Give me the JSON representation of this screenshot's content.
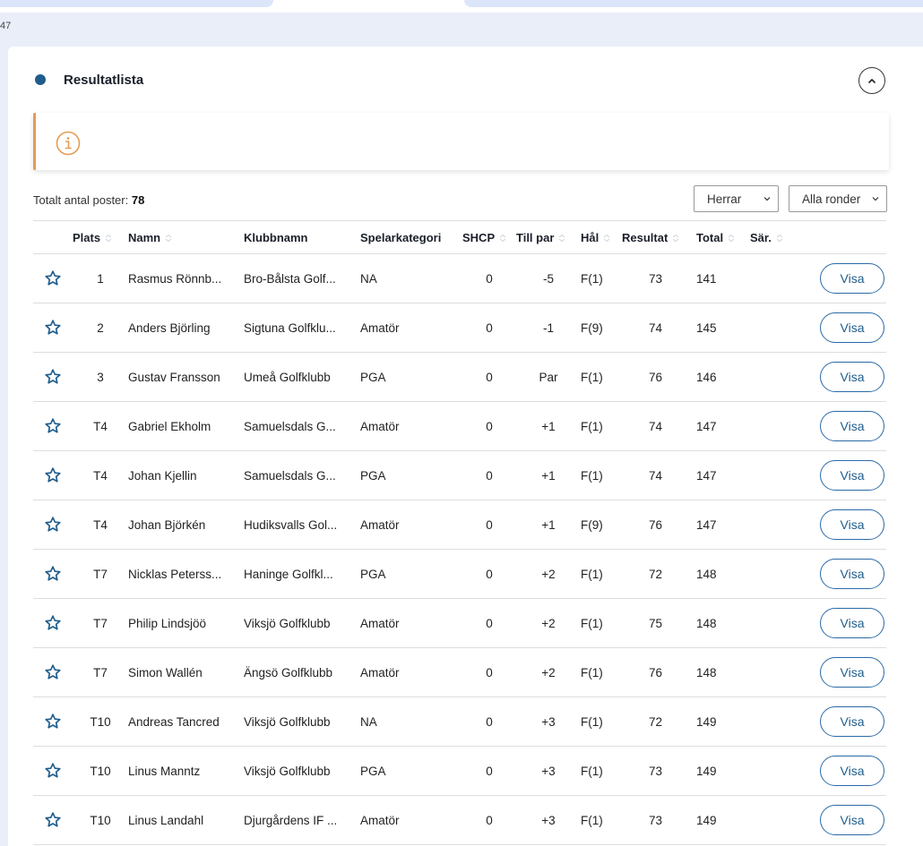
{
  "crumb": "47",
  "section": {
    "title": "Resultatlista"
  },
  "info": {
    "text": ""
  },
  "total": {
    "label": "Totalt antal poster: ",
    "count": "78"
  },
  "filters": {
    "gender": "Herrar",
    "rounds": "Alla ronder"
  },
  "columns": {
    "plats": "Plats",
    "namn": "Namn",
    "klubb": "Klubbnamn",
    "kategori": "Spelarkategori",
    "shcp": "SHCP",
    "tillpar": "Till par",
    "hal": "Hål",
    "resultat": "Resultat",
    "total": "Total",
    "sar": "Sär."
  },
  "visa_label": "Visa",
  "colors": {
    "accent": "#1f5d8c",
    "info": "#e59b56",
    "star": "#1f5d8c"
  },
  "rows": [
    {
      "plats": "1",
      "namn": "Rasmus Rönnb...",
      "klubb": "Bro-Bålsta Golf...",
      "kategori": "NA",
      "shcp": "0",
      "tillpar": "-5",
      "hal": "F(1)",
      "resultat": "73",
      "total": "141",
      "sar": ""
    },
    {
      "plats": "2",
      "namn": "Anders Björling",
      "klubb": "Sigtuna Golfklu...",
      "kategori": "Amatör",
      "shcp": "0",
      "tillpar": "-1",
      "hal": "F(9)",
      "resultat": "74",
      "total": "145",
      "sar": ""
    },
    {
      "plats": "3",
      "namn": "Gustav Fransson",
      "klubb": "Umeå Golfklubb",
      "kategori": "PGA",
      "shcp": "0",
      "tillpar": "Par",
      "hal": "F(1)",
      "resultat": "76",
      "total": "146",
      "sar": ""
    },
    {
      "plats": "T4",
      "namn": "Gabriel Ekholm",
      "klubb": "Samuelsdals G...",
      "kategori": "Amatör",
      "shcp": "0",
      "tillpar": "+1",
      "hal": "F(1)",
      "resultat": "74",
      "total": "147",
      "sar": ""
    },
    {
      "plats": "T4",
      "namn": "Johan Kjellin",
      "klubb": "Samuelsdals G...",
      "kategori": "PGA",
      "shcp": "0",
      "tillpar": "+1",
      "hal": "F(1)",
      "resultat": "74",
      "total": "147",
      "sar": ""
    },
    {
      "plats": "T4",
      "namn": "Johan Björkén",
      "klubb": "Hudiksvalls Gol...",
      "kategori": "Amatör",
      "shcp": "0",
      "tillpar": "+1",
      "hal": "F(9)",
      "resultat": "76",
      "total": "147",
      "sar": ""
    },
    {
      "plats": "T7",
      "namn": "Nicklas Peterss...",
      "klubb": "Haninge Golfkl...",
      "kategori": "PGA",
      "shcp": "0",
      "tillpar": "+2",
      "hal": "F(1)",
      "resultat": "72",
      "total": "148",
      "sar": ""
    },
    {
      "plats": "T7",
      "namn": "Philip Lindsjöö",
      "klubb": "Viksjö Golfklubb",
      "kategori": "Amatör",
      "shcp": "0",
      "tillpar": "+2",
      "hal": "F(1)",
      "resultat": "75",
      "total": "148",
      "sar": ""
    },
    {
      "plats": "T7",
      "namn": "Simon Wallén",
      "klubb": "Ängsö Golfklubb",
      "kategori": "Amatör",
      "shcp": "0",
      "tillpar": "+2",
      "hal": "F(1)",
      "resultat": "76",
      "total": "148",
      "sar": ""
    },
    {
      "plats": "T10",
      "namn": "Andreas Tancred",
      "klubb": "Viksjö Golfklubb",
      "kategori": "NA",
      "shcp": "0",
      "tillpar": "+3",
      "hal": "F(1)",
      "resultat": "72",
      "total": "149",
      "sar": ""
    },
    {
      "plats": "T10",
      "namn": "Linus Manntz",
      "klubb": "Viksjö Golfklubb",
      "kategori": "PGA",
      "shcp": "0",
      "tillpar": "+3",
      "hal": "F(1)",
      "resultat": "73",
      "total": "149",
      "sar": ""
    },
    {
      "plats": "T10",
      "namn": "Linus Landahl",
      "klubb": "Djurgårdens IF ...",
      "kategori": "Amatör",
      "shcp": "0",
      "tillpar": "+3",
      "hal": "F(1)",
      "resultat": "73",
      "total": "149",
      "sar": ""
    }
  ]
}
